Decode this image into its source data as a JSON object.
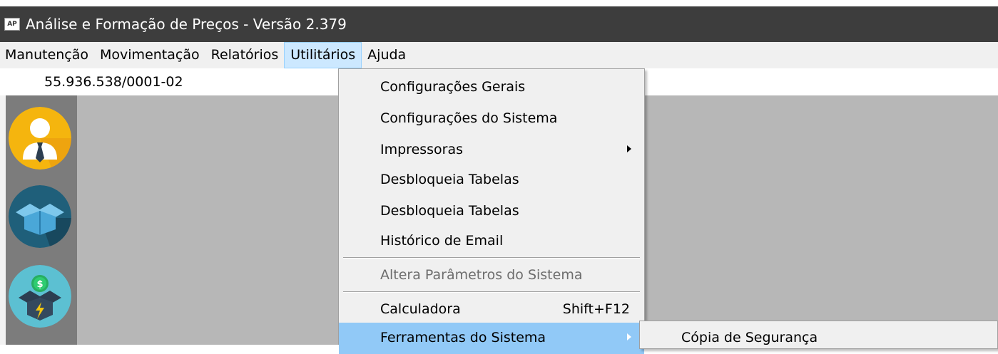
{
  "window": {
    "icon_text": "AP",
    "title": "Análise e Formação de Preços - Versão 2.379"
  },
  "menubar": {
    "items": [
      "Manutenção",
      "Movimentação",
      "Relatórios",
      "Utilitários",
      "Ajuda"
    ],
    "active": "Utilitários"
  },
  "company": {
    "cnpj": "55.936.538/0001-02"
  },
  "sidebar": {
    "icons": [
      "user-icon",
      "box-icon",
      "money-box-icon"
    ],
    "colors": {
      "user": "#f5b50e",
      "box": "#1f5f7a",
      "money": "#5cc0d2"
    }
  },
  "utilitarios_menu": {
    "items": [
      {
        "label": "Configurações Gerais"
      },
      {
        "label": "Configurações do Sistema"
      },
      {
        "label": "Impressoras",
        "submenu": true
      },
      {
        "label": "Desbloqueia Tabelas"
      },
      {
        "label": "Desbloqueia Tabelas"
      },
      {
        "label": "Histórico de Email"
      },
      {
        "label": "Altera Parâmetros do Sistema",
        "disabled": true
      },
      {
        "label": "Calculadora",
        "shortcut": "Shift+F12"
      },
      {
        "label": "Ferramentas do Sistema",
        "submenu": true,
        "highlighted": true
      }
    ]
  },
  "ferramentas_submenu": {
    "items": [
      "Cópia de Segurança"
    ]
  }
}
